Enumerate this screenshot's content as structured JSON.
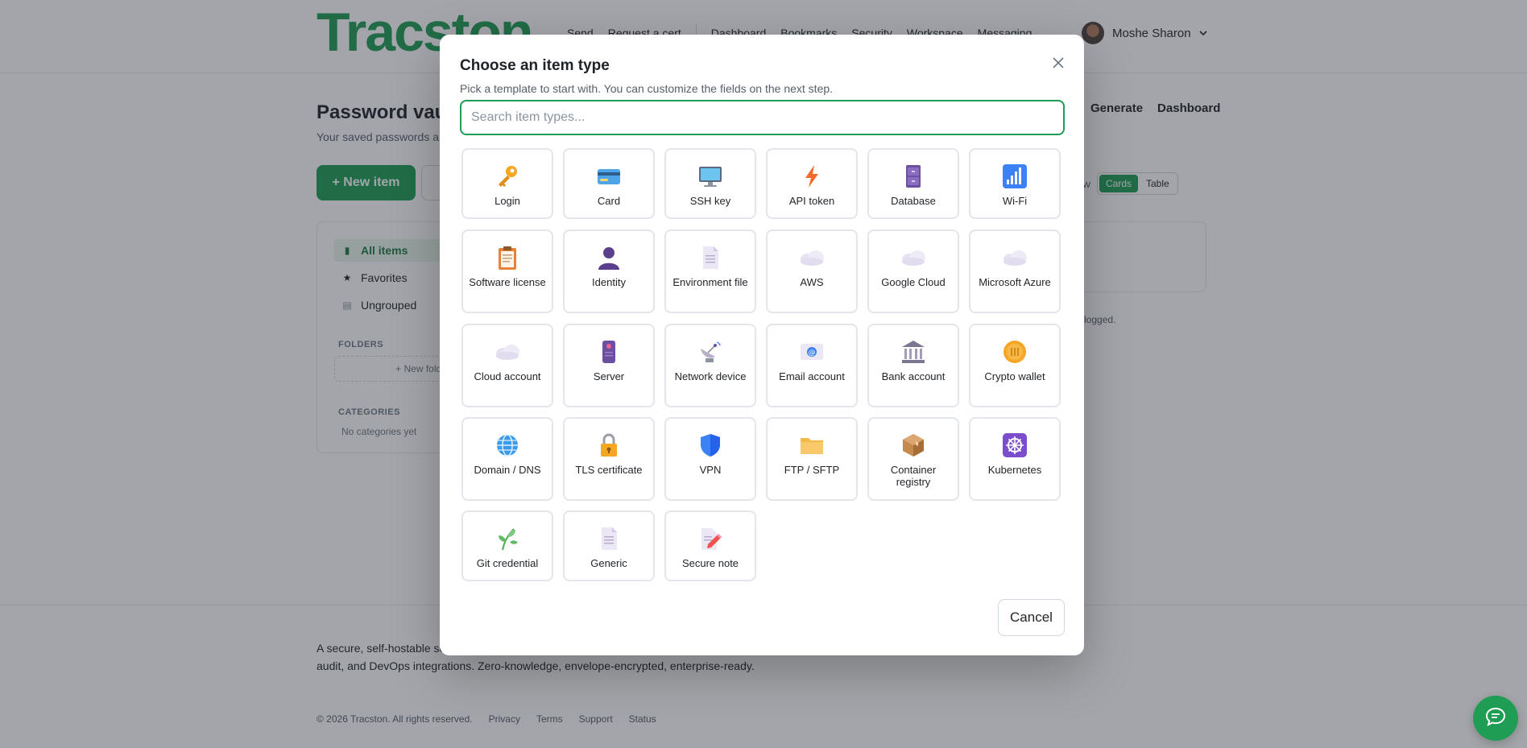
{
  "brand": {
    "logo_text": "Tracston",
    "accent": "#1f9d55"
  },
  "nav": {
    "links": [
      "Send",
      "Request a cert",
      "Dashboard",
      "Bookmarks",
      "Security",
      "Workspace",
      "Messaging"
    ],
    "user_name": "Moshe Sharon"
  },
  "page": {
    "title": "Password vault",
    "subtitle": "Your saved passwords and secrets",
    "actions": [
      "Generate",
      "Dashboard"
    ],
    "new_item_label": "+ New item",
    "view_label": "View",
    "view_options": {
      "cards": "Cards",
      "table": "Table"
    },
    "logged_note": "logged."
  },
  "sidebar": {
    "items": [
      {
        "label": "All items",
        "icon": "vault-icon"
      },
      {
        "label": "Favorites",
        "icon": "star-icon"
      },
      {
        "label": "Ungrouped",
        "icon": "document-icon"
      }
    ],
    "folders_heading": "FOLDERS",
    "new_folder_label": "+ New folder",
    "categories_heading": "CATEGORIES",
    "categories_empty": "No categories yet"
  },
  "footer": {
    "description": "A secure, self-hostable secrets manager for teams. Store passwords, credentials and files, with organization policy, audit, and DevOps integrations. Zero-knowledge, envelope-encrypted, enterprise-ready.",
    "copyright": "© 2026 Tracston. All rights reserved.",
    "links": [
      "Privacy",
      "Terms",
      "Support",
      "Status"
    ]
  },
  "modal": {
    "title": "Choose an item type",
    "subtitle": "Pick a template to start with. You can customize the fields on the next step.",
    "search_placeholder": "Search item types...",
    "cancel_label": "Cancel",
    "types": [
      {
        "label": "Login",
        "icon": "key-icon"
      },
      {
        "label": "Card",
        "icon": "credit-card-icon"
      },
      {
        "label": "SSH key",
        "icon": "monitor-icon"
      },
      {
        "label": "API token",
        "icon": "lightning-icon"
      },
      {
        "label": "Database",
        "icon": "file-cabinet-icon"
      },
      {
        "label": "Wi-Fi",
        "icon": "signal-bars-icon"
      },
      {
        "label": "Software license",
        "icon": "clipboard-icon"
      },
      {
        "label": "Identity",
        "icon": "person-icon"
      },
      {
        "label": "Environment file",
        "icon": "document-icon"
      },
      {
        "label": "AWS",
        "icon": "cloud-icon"
      },
      {
        "label": "Google Cloud",
        "icon": "cloud-icon"
      },
      {
        "label": "Microsoft Azure",
        "icon": "cloud-icon"
      },
      {
        "label": "Cloud account",
        "icon": "cloud-icon"
      },
      {
        "label": "Server",
        "icon": "server-icon"
      },
      {
        "label": "Network device",
        "icon": "satellite-dish-icon"
      },
      {
        "label": "Email account",
        "icon": "email-icon"
      },
      {
        "label": "Bank account",
        "icon": "bank-icon"
      },
      {
        "label": "Crypto wallet",
        "icon": "coin-icon"
      },
      {
        "label": "Domain / DNS",
        "icon": "globe-icon"
      },
      {
        "label": "TLS certificate",
        "icon": "lock-icon"
      },
      {
        "label": "VPN",
        "icon": "shield-icon"
      },
      {
        "label": "FTP / SFTP",
        "icon": "folder-icon"
      },
      {
        "label": "Container registry",
        "icon": "package-icon"
      },
      {
        "label": "Kubernetes",
        "icon": "helm-wheel-icon"
      },
      {
        "label": "Git credential",
        "icon": "herb-icon"
      },
      {
        "label": "Generic",
        "icon": "document-icon"
      },
      {
        "label": "Secure note",
        "icon": "note-pencil-icon"
      }
    ]
  }
}
